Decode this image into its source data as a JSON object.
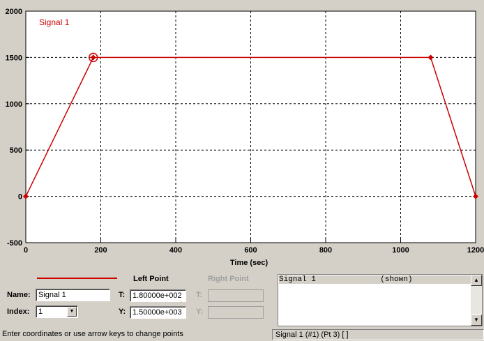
{
  "plot": {
    "legend_label": "Signal 1",
    "colors": {
      "signal": "#cc0000",
      "grid": "#000000",
      "background": "#ffffff",
      "selected_marker": "circle-diamond"
    }
  },
  "chart_data": {
    "type": "line",
    "xlabel": "Time (sec)",
    "ylabel": "",
    "xlim": [
      0,
      1200
    ],
    "ylim": [
      -500,
      2000
    ],
    "xticks": [
      0,
      200,
      400,
      600,
      800,
      1000,
      1200
    ],
    "yticks": [
      -500,
      0,
      500,
      1000,
      1500,
      2000
    ],
    "grid": true,
    "legend_placement": "top-left",
    "series": [
      {
        "name": "Signal 1",
        "color": "#cc0000",
        "x": [
          0,
          180,
          1080,
          1200
        ],
        "y": [
          0,
          1500,
          1500,
          0
        ],
        "selected_point_index": 1
      }
    ]
  },
  "editor": {
    "left_point_label": "Left Point",
    "right_point_label": "Right Point",
    "name_label": "Name:",
    "name_value": "Signal 1",
    "index_label": "Index:",
    "index_value": "1",
    "left_t_label": "T:",
    "left_t_value": "1.80000e+002",
    "left_y_label": "Y:",
    "left_y_value": "1.50000e+003",
    "right_t_label": "T:",
    "right_y_label": "Y:"
  },
  "signal_list": {
    "rows": [
      {
        "name": "Signal 1",
        "state": "(shown)"
      }
    ]
  },
  "status": {
    "message": "Enter coordinates or use arrow keys to change points",
    "selection": "Signal 1 (#1) (Pt 3)  [ ]"
  }
}
